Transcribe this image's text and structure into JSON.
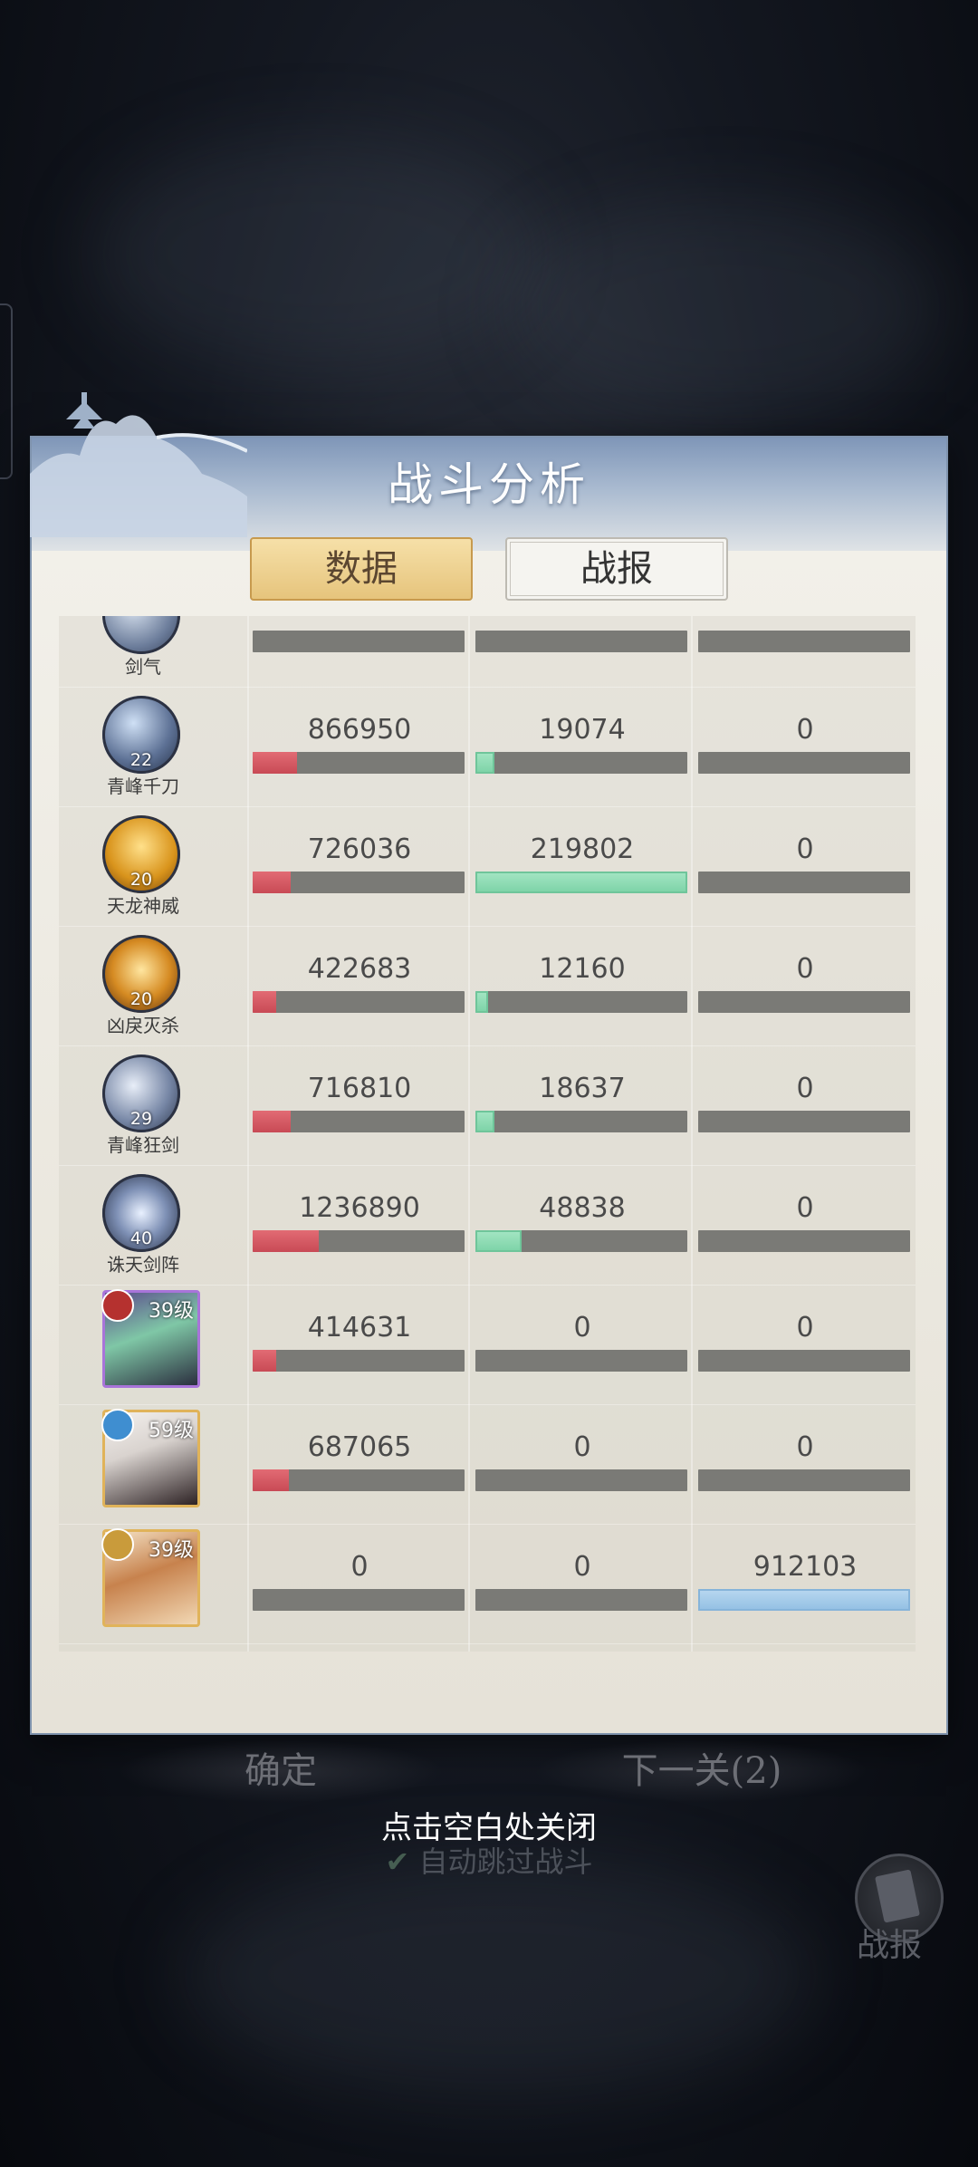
{
  "title": "战斗分析",
  "tabs": {
    "data": "数据",
    "report": "战报"
  },
  "partial_top": {
    "name": "剑气"
  },
  "rows": [
    {
      "kind": "skill",
      "name": "青峰千刀",
      "level": "22",
      "icon": "swirl-blade-icon",
      "values": [
        "866950",
        "19074",
        "0"
      ],
      "fills": [
        0.21,
        0.09,
        0.0
      ]
    },
    {
      "kind": "skill",
      "name": "天龙神威",
      "level": "20",
      "icon": "golden-dragon-icon",
      "values": [
        "726036",
        "219802",
        "0"
      ],
      "fills": [
        0.18,
        1.0,
        0.0
      ]
    },
    {
      "kind": "skill",
      "name": "凶戾灭杀",
      "level": "20",
      "icon": "flame-sigil-icon",
      "values": [
        "422683",
        "12160",
        "0"
      ],
      "fills": [
        0.11,
        0.06,
        0.0
      ]
    },
    {
      "kind": "skill",
      "name": "青峰狂剑",
      "level": "29",
      "icon": "sword-strike-icon",
      "values": [
        "716810",
        "18637",
        "0"
      ],
      "fills": [
        0.18,
        0.09,
        0.0
      ]
    },
    {
      "kind": "skill",
      "name": "诛天剑阵",
      "level": "40",
      "icon": "sword-array-icon",
      "values": [
        "1236890",
        "48838",
        "0"
      ],
      "fills": [
        0.31,
        0.22,
        0.0
      ]
    },
    {
      "kind": "hero",
      "name": "",
      "level": "39级",
      "icon": "green-hair-hero-portrait",
      "values": [
        "414631",
        "0",
        "0"
      ],
      "fills": [
        0.11,
        0.0,
        0.0
      ]
    },
    {
      "kind": "hero",
      "name": "",
      "level": "59级",
      "icon": "white-hair-hero-portrait",
      "values": [
        "687065",
        "0",
        "0"
      ],
      "fills": [
        0.17,
        0.0,
        0.0
      ]
    },
    {
      "kind": "hero",
      "name": "",
      "level": "39级",
      "icon": "brown-hair-hero-portrait",
      "values": [
        "0",
        "0",
        "912103"
      ],
      "fills": [
        0.0,
        0.0,
        1.0
      ]
    }
  ],
  "bottom": {
    "confirm": "确定",
    "next": "下一关(2)",
    "close_hint": "点击空白处关闭",
    "auto_skip": "自动跳过战斗",
    "report_label": "战报"
  },
  "colors": {
    "damage": "#c84a55",
    "heal": "#7bd2a6",
    "shield": "#92bfe3",
    "bar_bg": "#7a7a76"
  }
}
